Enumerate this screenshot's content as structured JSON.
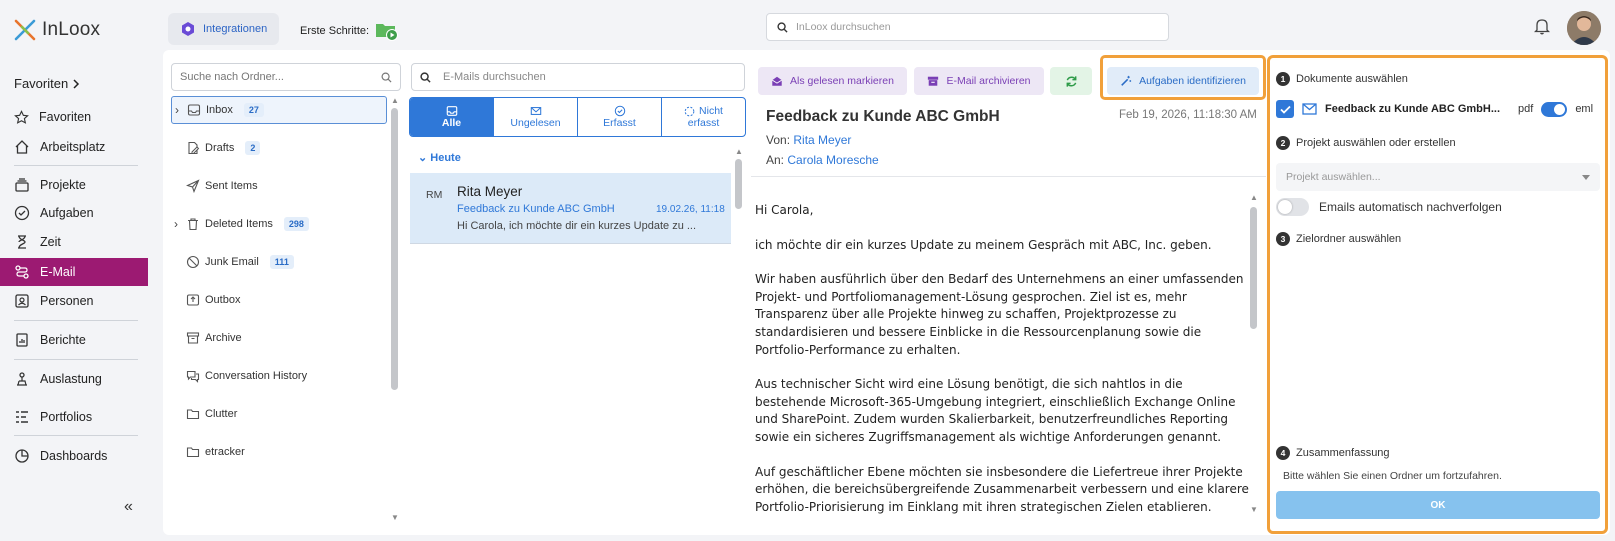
{
  "app": {
    "name": "InLoox"
  },
  "sidebar": {
    "favorites_header": "Favoriten",
    "items": [
      {
        "label": "Favoriten",
        "icon": "star-icon"
      },
      {
        "label": "Arbeitsplatz",
        "icon": "home-icon"
      },
      {
        "label": "Projekte",
        "icon": "layers-icon"
      },
      {
        "label": "Aufgaben",
        "icon": "check-circle-icon"
      },
      {
        "label": "Zeit",
        "icon": "hourglass-icon"
      },
      {
        "label": "E-Mail",
        "icon": "mail-route-icon",
        "active": true
      },
      {
        "label": "Personen",
        "icon": "contact-card-icon"
      },
      {
        "label": "Berichte",
        "icon": "report-icon"
      },
      {
        "label": "Auslastung",
        "icon": "workload-icon"
      },
      {
        "label": "Portfolios",
        "icon": "portfolio-icon"
      },
      {
        "label": "Dashboards",
        "icon": "pie-icon"
      }
    ],
    "collapse_label": "«"
  },
  "topbar": {
    "integrations_label": "Integrationen",
    "first_steps_label": "Erste Schritte:",
    "search_placeholder": "InLoox durchsuchen"
  },
  "folders": {
    "search_placeholder": "Suche nach Ordner...",
    "items": [
      {
        "label": "Inbox",
        "count": "27"
      },
      {
        "label": "Drafts",
        "count": "2"
      },
      {
        "label": "Sent Items",
        "count": ""
      },
      {
        "label": "Deleted Items",
        "count": "298"
      },
      {
        "label": "Junk Email",
        "count": "111"
      },
      {
        "label": "Outbox",
        "count": ""
      },
      {
        "label": "Archive",
        "count": ""
      },
      {
        "label": "Conversation History",
        "count": ""
      },
      {
        "label": "Clutter",
        "count": ""
      },
      {
        "label": "etracker",
        "count": ""
      }
    ]
  },
  "maillist": {
    "search_placeholder": "E-Mails durchsuchen",
    "filters": [
      {
        "label": "Alle"
      },
      {
        "label": "Ungelesen"
      },
      {
        "label": "Erfasst"
      },
      {
        "label1": "Nicht",
        "label2": "erfasst"
      }
    ],
    "group": "Heute",
    "item": {
      "initials": "RM",
      "sender": "Rita Meyer",
      "subject": "Feedback zu Kunde ABC GmbH",
      "date": "19.02.26, 11:18",
      "preview": "Hi Carola, ich möchte dir ein kurzes Update zu ..."
    }
  },
  "reading": {
    "toolbar": {
      "mark_read": "Als gelesen markieren",
      "archive": "E-Mail archivieren",
      "identify": "Aufgaben identifizieren"
    },
    "subject": "Feedback zu Kunde ABC GmbH",
    "date": "Feb 19, 2026, 11:18:30 AM",
    "from_label": "Von:",
    "from": "Rita Meyer",
    "to_label": "An:",
    "to": "Carola Moresche",
    "body": [
      "Hi Carola,",
      "ich möchte dir ein kurzes Update zu meinem Gespräch mit ABC, Inc. geben.",
      "Wir haben ausführlich über den Bedarf des Unternehmens an einer umfassenden Projekt- und Portfoliomanagement-Lösung gesprochen. Ziel ist es, mehr Transparenz über alle Projekte hinweg zu schaffen, Projektprozesse zu standardisieren und bessere Einblicke in die Ressourcenplanung sowie die Portfolio-Performance zu erhalten.",
      "Aus technischer Sicht wird eine Lösung benötigt, die sich nahtlos in die bestehende Microsoft-365-Umgebung integriert, einschließlich Exchange Online und SharePoint. Zudem wurden Skalierbarkeit, benutzerfreundliches Reporting sowie ein sicheres Zugriffsmanagement als wichtige Anforderungen genannt.",
      "Auf geschäftlicher Ebene möchten sie insbesondere die Liefertreue ihrer Projekte erhöhen, die bereichsübergreifende Zusammenarbeit verbessern und eine klarere Portfolio-Priorisierung im Einklang mit ihren strategischen Zielen etablieren."
    ]
  },
  "panel": {
    "step1": {
      "num": "1",
      "label": "Dokumente auswählen"
    },
    "document": {
      "name": "Feedback zu Kunde ABC GmbH...",
      "pdf_label": "pdf",
      "eml_label": "eml"
    },
    "step2": {
      "num": "2",
      "label": "Projekt auswählen oder erstellen"
    },
    "project_placeholder": "Projekt auswählen...",
    "auto_follow_label": "Emails automatisch nachverfolgen",
    "step3": {
      "num": "3",
      "label": "Zielordner auswählen"
    },
    "step4": {
      "num": "4",
      "label": "Zusammenfassung"
    },
    "summary_text": "Bitte wählen Sie einen Ordner um fortzufahren.",
    "ok_label": "OK"
  },
  "colors": {
    "accent": "#2f78d8",
    "active_nav": "#9c1a72",
    "highlight": "#f1a03a"
  }
}
